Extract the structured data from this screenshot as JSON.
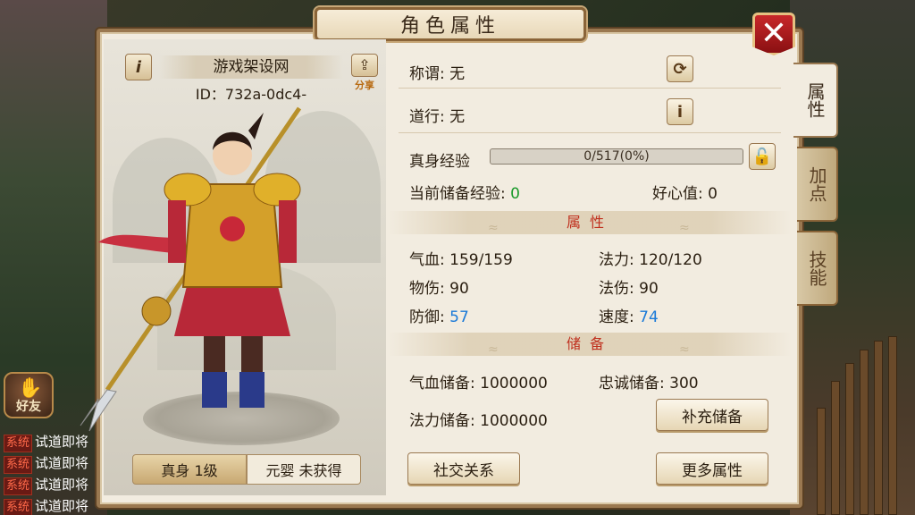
{
  "window": {
    "title": "角色属性",
    "close_label": "✕"
  },
  "side_tabs": [
    {
      "label": "属性",
      "active": true
    },
    {
      "label": "加点",
      "active": false
    },
    {
      "label": "技能",
      "active": false
    }
  ],
  "character": {
    "name": "游戏架设网",
    "id_text": "ID：732a-0dc4-",
    "share_label": "分享",
    "body_tab": "真身 1级",
    "yuanying_tab": "元婴 未获得"
  },
  "info": {
    "title_label": "称谓: 无",
    "dao_label": "道行: 无",
    "exp_label": "真身经验",
    "exp_text": "0/517(0%)",
    "exp_percent": 0,
    "stored_exp_label": "当前储备经验: ",
    "stored_exp_value": "0",
    "goodwill": "好心值: 0"
  },
  "attributes": {
    "section": "属性",
    "hp": "气血: 159/159",
    "mp": "法力: 120/120",
    "phys_dmg": "物伤: 90",
    "mag_dmg": "法伤: 90",
    "defense_label": "防御: ",
    "defense_value": "57",
    "speed_label": "速度: ",
    "speed_value": "74"
  },
  "reserve": {
    "section": "储备",
    "hp_reserve": "气血储备: 1000000",
    "loyalty_reserve": "忠诚储备: 300",
    "mp_reserve": "法力储备: 1000000",
    "refill_button": "补充储备"
  },
  "buttons": {
    "social": "社交关系",
    "more_attrs": "更多属性"
  },
  "friend_button": "好友",
  "chat": {
    "tag": "系统",
    "lines": [
      "试道即将",
      "试道即将",
      "试道即将",
      "试道即将"
    ]
  }
}
